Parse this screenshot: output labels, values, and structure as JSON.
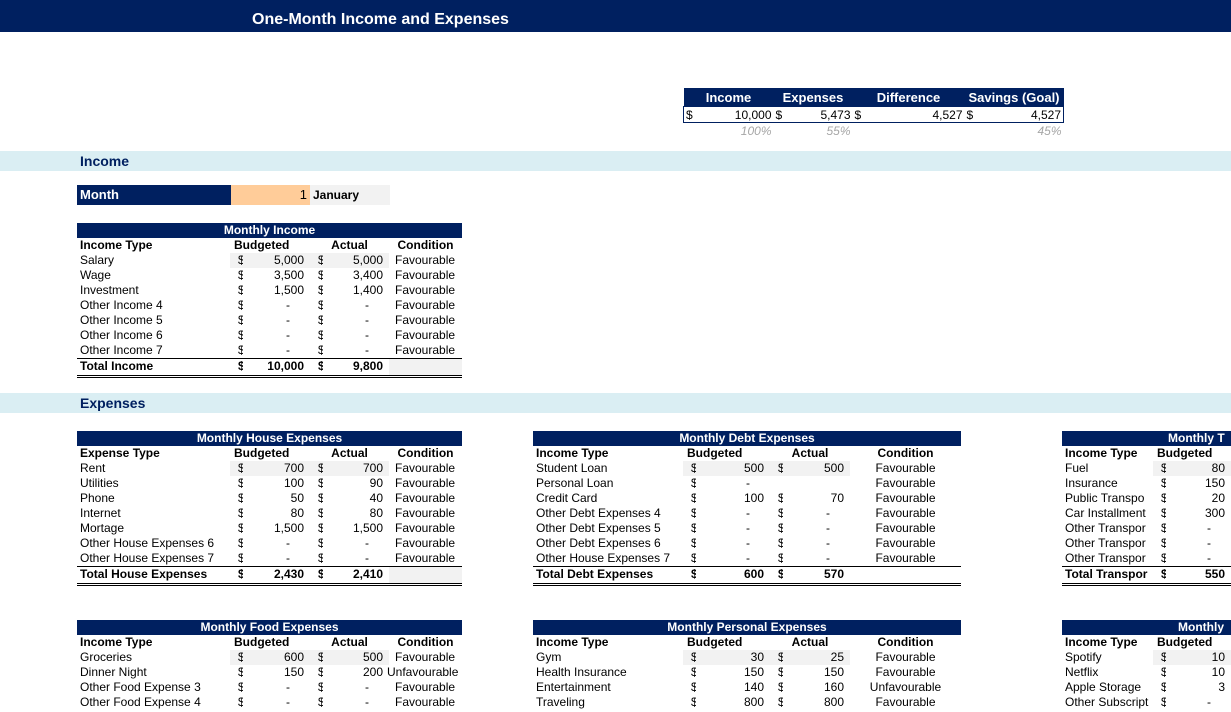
{
  "header": {
    "title": "One-Month Income and Expenses"
  },
  "colors": {
    "navy": "#002060",
    "band": "#DAEEF3",
    "month_input": "#FFCC99",
    "shade": "#F2F2F2"
  },
  "summary": {
    "headers": [
      "Income",
      "Expenses",
      "Difference",
      "Savings (Goal)"
    ],
    "currency": "$",
    "values": [
      "10,000",
      "5,473",
      "4,527",
      "4,527"
    ],
    "percents": [
      "100%",
      "55%",
      "",
      "45%"
    ]
  },
  "sections": {
    "income": "Income",
    "expenses": "Expenses"
  },
  "month": {
    "label": "Month",
    "number": "1",
    "name": "January"
  },
  "tables": {
    "income": {
      "title": "Monthly Income",
      "headers": [
        "Income Type",
        "Budgeted",
        "Actual",
        "Condition"
      ],
      "rows": [
        [
          "Salary",
          "5,000",
          "5,000",
          "Favourable"
        ],
        [
          "Wage",
          "3,500",
          "3,400",
          "Favourable"
        ],
        [
          "Investment",
          "1,500",
          "1,400",
          "Favourable"
        ],
        [
          "Other Income 4",
          "-",
          "-",
          "Favourable"
        ],
        [
          "Other Income 5",
          "-",
          "-",
          "Favourable"
        ],
        [
          "Other Income 6",
          "-",
          "-",
          "Favourable"
        ],
        [
          "Other Income 7",
          "-",
          "-",
          "Favourable"
        ]
      ],
      "total": [
        "Total Income",
        "10,000",
        "9,800",
        ""
      ]
    },
    "house": {
      "title": "Monthly House Expenses",
      "headers": [
        "Expense Type",
        "Budgeted",
        "Actual",
        "Condition"
      ],
      "rows": [
        [
          "Rent",
          "700",
          "700",
          "Favourable"
        ],
        [
          "Utilities",
          "100",
          "90",
          "Favourable"
        ],
        [
          "Phone",
          "50",
          "40",
          "Favourable"
        ],
        [
          "Internet",
          "80",
          "80",
          "Favourable"
        ],
        [
          "Mortage",
          "1,500",
          "1,500",
          "Favourable"
        ],
        [
          "Other House Expenses 6",
          "-",
          "-",
          "Favourable"
        ],
        [
          "Other House Expenses 7",
          "-",
          "-",
          "Favourable"
        ]
      ],
      "total": [
        "Total House Expenses",
        "2,430",
        "2,410",
        ""
      ]
    },
    "debt": {
      "title": "Monthly Debt Expenses",
      "headers": [
        "Income Type",
        "Budgeted",
        "Actual",
        "Condition"
      ],
      "rows": [
        [
          "Student Loan",
          "500",
          "500",
          "Favourable"
        ],
        [
          "Personal Loan",
          "-",
          "",
          "Favourable"
        ],
        [
          "Credit Card",
          "100",
          "70",
          "Favourable"
        ],
        [
          "Other Debt Expenses 4",
          "-",
          "-",
          "Favourable"
        ],
        [
          "Other Debt Expenses 5",
          "-",
          "-",
          "Favourable"
        ],
        [
          "Other Debt Expenses 6",
          "-",
          "-",
          "Favourable"
        ],
        [
          "Other House Expenses 7",
          "-",
          "-",
          "Favourable"
        ]
      ],
      "total": [
        "Total Debt Expenses",
        "600",
        "570",
        ""
      ]
    },
    "transport": {
      "title": "Monthly T",
      "headers": [
        "Income Type",
        "Budgeted"
      ],
      "rows": [
        [
          "Fuel",
          "80"
        ],
        [
          "Insurance",
          "150"
        ],
        [
          "Public Transpo",
          "20"
        ],
        [
          "Car Installment",
          "300"
        ],
        [
          "Other Transpor",
          "-"
        ],
        [
          "Other Transpor",
          "-"
        ],
        [
          "Other Transpor",
          "-"
        ]
      ],
      "total": [
        "Total Transpor",
        "550"
      ]
    },
    "food": {
      "title": "Monthly Food Expenses",
      "headers": [
        "Income Type",
        "Budgeted",
        "Actual",
        "Condition"
      ],
      "rows": [
        [
          "Groceries",
          "600",
          "500",
          "Favourable"
        ],
        [
          "Dinner Night",
          "150",
          "200",
          "Unfavourable"
        ],
        [
          "Other Food Expense 3",
          "-",
          "-",
          "Favourable"
        ],
        [
          "Other Food Expense 4",
          "-",
          "-",
          "Favourable"
        ]
      ]
    },
    "personal": {
      "title": "Monthly Personal Expenses",
      "headers": [
        "Income Type",
        "Budgeted",
        "Actual",
        "Condition"
      ],
      "rows": [
        [
          "Gym",
          "30",
          "25",
          "Favourable"
        ],
        [
          "Health Insurance",
          "150",
          "150",
          "Favourable"
        ],
        [
          "Entertainment",
          "140",
          "160",
          "Unfavourable"
        ],
        [
          "Traveling",
          "800",
          "800",
          "Favourable"
        ]
      ]
    },
    "subscriptions": {
      "title": "Monthly",
      "headers": [
        "Income Type",
        "Budgeted"
      ],
      "rows": [
        [
          "Spotify",
          "10"
        ],
        [
          "Netflix",
          "10"
        ],
        [
          "Apple Storage",
          "3"
        ],
        [
          "Other Subscript",
          "-"
        ]
      ]
    }
  }
}
